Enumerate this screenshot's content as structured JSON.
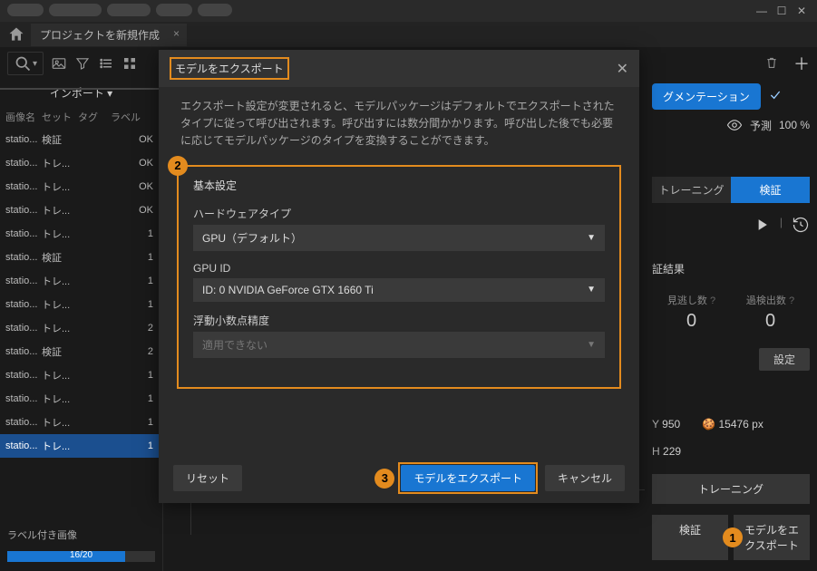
{
  "titlebar": {
    "pills": [
      40,
      58,
      48,
      40,
      38
    ]
  },
  "tab": {
    "label": "プロジェクトを新規作成"
  },
  "import_label": "インポート ▾",
  "columns": {
    "c1": "画像名",
    "c2": "セット",
    "c3": "タグ",
    "c4": "ラベル"
  },
  "rows": [
    {
      "name": "statio...",
      "set": "検証",
      "tag": "",
      "label": "OK",
      "selected": false
    },
    {
      "name": "statio...",
      "set": "トレ...",
      "tag": "",
      "label": "OK",
      "selected": false
    },
    {
      "name": "statio...",
      "set": "トレ...",
      "tag": "",
      "label": "OK",
      "selected": false
    },
    {
      "name": "statio...",
      "set": "トレ...",
      "tag": "",
      "label": "OK",
      "selected": false
    },
    {
      "name": "statio...",
      "set": "トレ...",
      "tag": "",
      "label": "1",
      "selected": false
    },
    {
      "name": "statio...",
      "set": "検証",
      "tag": "",
      "label": "1",
      "selected": false
    },
    {
      "name": "statio...",
      "set": "トレ...",
      "tag": "",
      "label": "1",
      "selected": false
    },
    {
      "name": "statio...",
      "set": "トレ...",
      "tag": "",
      "label": "1",
      "selected": false
    },
    {
      "name": "statio...",
      "set": "トレ...",
      "tag": "",
      "label": "2",
      "selected": false
    },
    {
      "name": "statio...",
      "set": "検証",
      "tag": "",
      "label": "2",
      "selected": false
    },
    {
      "name": "statio...",
      "set": "トレ...",
      "tag": "",
      "label": "1",
      "selected": false
    },
    {
      "name": "statio...",
      "set": "トレ...",
      "tag": "",
      "label": "1",
      "selected": false
    },
    {
      "name": "statio...",
      "set": "トレ...",
      "tag": "",
      "label": "1",
      "selected": false
    },
    {
      "name": "statio...",
      "set": "トレ...",
      "tag": "",
      "label": "1",
      "selected": true
    }
  ],
  "labeled_images": "ラベル付き画像",
  "progress_text": "16/20",
  "right": {
    "segmentation": "グメンテーション",
    "predict_label": "予測",
    "predict_pct": "100 %",
    "tab_training": "トレーニング",
    "tab_validation": "検証",
    "result_heading": "証結果",
    "miss_label": "見逃し数",
    "miss_value": "0",
    "over_label": "過検出数",
    "over_value": "0",
    "settings_btn": "設定",
    "y_label": "Y",
    "y_value": "950",
    "px_value": "15476 px",
    "h_label": "H",
    "h_value": "229",
    "training_btn": "トレーニング",
    "validate_btn": "検証",
    "export_btn": "モデルをエクスポート"
  },
  "modal": {
    "title": "モデルをエクスポート",
    "description": "エクスポート設定が変更されると、モデルパッケージはデフォルトでエクスポートされたタイプに従って呼び出されます。呼び出すには数分間かかります。呼び出した後でも必要に応じてモデルパッケージのタイプを変換することができます。",
    "section": "基本設定",
    "hw_label": "ハードウェアタイプ",
    "hw_value": "GPU（デフォルト）",
    "gpu_label": "GPU ID",
    "gpu_value": "ID: 0  NVIDIA GeForce GTX 1660 Ti",
    "precision_label": "浮動小数点精度",
    "precision_value": "適用できない",
    "reset": "リセット",
    "export": "モデルをエクスポート",
    "cancel": "キャンセル"
  },
  "badges": {
    "b1": "1",
    "b2": "2",
    "b3": "3"
  }
}
